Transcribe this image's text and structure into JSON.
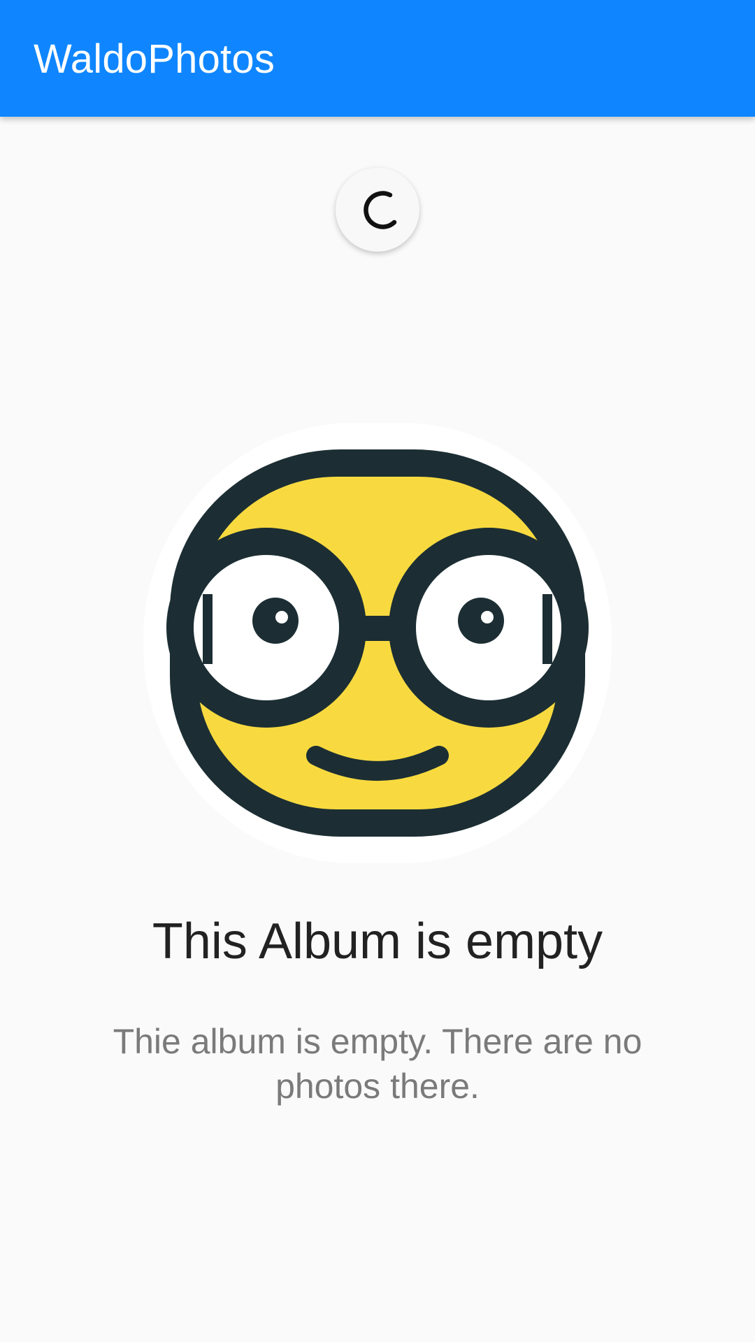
{
  "app_bar": {
    "title": "WaldoPhotos",
    "background": "#0f86ff"
  },
  "loading": {
    "icon": "loading-spinner"
  },
  "empty_state": {
    "illustration_icon": "nerd-face-icon",
    "title": "This Album is empty",
    "description": "Thie album is empty. There are no photos there."
  },
  "colors": {
    "face_yellow": "#f8da40",
    "outline": "#1c2e33",
    "background": "#fafafa"
  }
}
